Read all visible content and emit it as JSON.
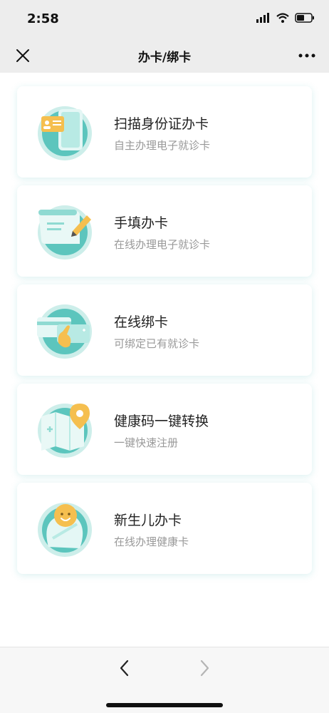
{
  "status_bar": {
    "time": "2:58"
  },
  "nav": {
    "title": "办卡/绑卡"
  },
  "cards": [
    {
      "title": "扫描身份证办卡",
      "subtitle": "自主办理电子就诊卡",
      "icon": "id-card-scan-icon"
    },
    {
      "title": "手填办卡",
      "subtitle": "在线办理电子就诊卡",
      "icon": "form-edit-icon"
    },
    {
      "title": "在线绑卡",
      "subtitle": "可绑定已有就诊卡",
      "icon": "card-bind-icon"
    },
    {
      "title": "健康码一键转换",
      "subtitle": "一键快速注册",
      "icon": "health-map-icon"
    },
    {
      "title": "新生儿办卡",
      "subtitle": "在线办理健康卡",
      "icon": "newborn-icon"
    }
  ],
  "colors": {
    "accent": "#5cc5bd",
    "accent_light": "#cdeeea",
    "highlight": "#f5bf4f"
  }
}
